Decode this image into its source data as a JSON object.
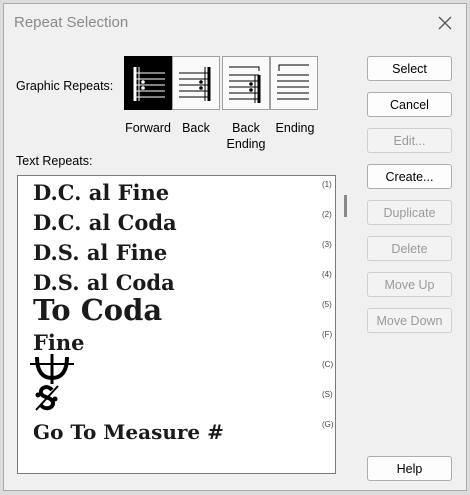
{
  "dialog": {
    "title": "Repeat Selection"
  },
  "graphic_repeats": {
    "label": "Graphic Repeats:",
    "options": [
      {
        "label": "Forward",
        "selected": true
      },
      {
        "label": "Back",
        "selected": false
      },
      {
        "label": "Back Ending",
        "selected": false
      },
      {
        "label": "Ending",
        "selected": false
      }
    ]
  },
  "text_repeats": {
    "label": "Text Repeats:",
    "items": [
      {
        "text": "D.C. al Fine",
        "tag": "(1)"
      },
      {
        "text": "D.C. al Coda",
        "tag": "(2)"
      },
      {
        "text": "D.S. al Fine",
        "tag": "(3)"
      },
      {
        "text": "D.S. al Coda",
        "tag": "(4)"
      },
      {
        "text": "To Coda",
        "tag": "(5)"
      },
      {
        "text": "Fine",
        "tag": "(F)"
      },
      {
        "text": "",
        "tag": "(C)",
        "icon": "coda-symbol-icon"
      },
      {
        "text": "",
        "tag": "(S)",
        "icon": "segno-symbol-icon"
      },
      {
        "text": "Go To Measure #",
        "tag": "(G)"
      }
    ]
  },
  "buttons": {
    "select": "Select",
    "cancel": "Cancel",
    "edit": "Edit...",
    "create": "Create...",
    "duplicate": "Duplicate",
    "delete": "Delete",
    "move_up": "Move Up",
    "move_down": "Move Down",
    "help": "Help"
  }
}
